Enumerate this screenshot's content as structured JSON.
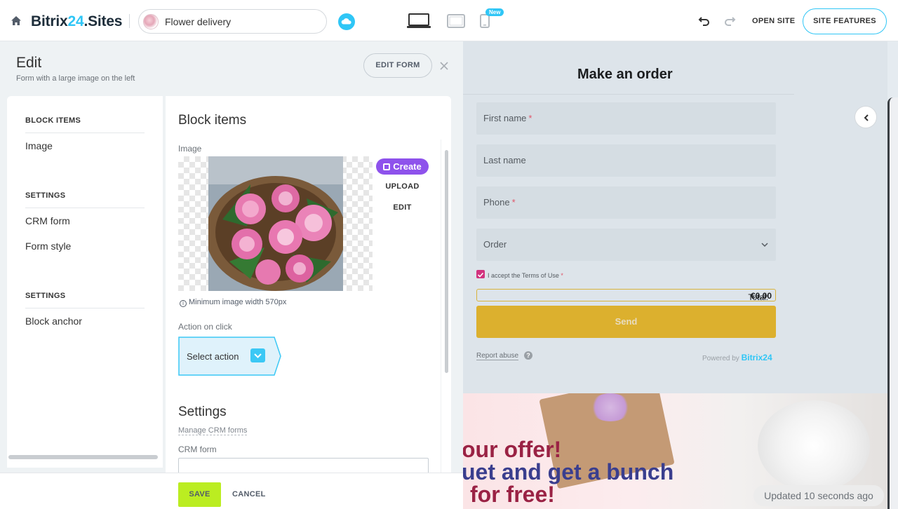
{
  "topbar": {
    "logo_part1": "Bitrix",
    "logo_part2": "24",
    "logo_part3": ".Sites",
    "site_name": "Flower delivery",
    "new_badge": "New",
    "open_site": "OPEN SITE",
    "site_features": "SITE FEATURES"
  },
  "edit": {
    "title": "Edit",
    "subtitle": "Form with a large image on the left",
    "edit_form_button": "EDIT FORM"
  },
  "sidebar": {
    "sections": [
      {
        "heading": "BLOCK ITEMS",
        "items": [
          "Image"
        ]
      },
      {
        "heading": "SETTINGS",
        "items": [
          "CRM form",
          "Form style"
        ]
      },
      {
        "heading": "SETTINGS",
        "items": [
          "Block anchor"
        ]
      }
    ]
  },
  "content": {
    "block_items_title": "Block items",
    "image_label": "Image",
    "create_button": "Create",
    "upload_button": "UPLOAD",
    "edit_button": "EDIT",
    "min_width_note": "Minimum image width 570px",
    "action_label": "Action on click",
    "select_action": "Select action",
    "settings_title": "Settings",
    "manage_crm_forms": "Manage CRM forms",
    "crm_form_label": "CRM form"
  },
  "footer": {
    "save": "SAVE",
    "cancel": "CANCEL"
  },
  "preview": {
    "form_title": "Make an order",
    "fields": [
      {
        "label": "First name",
        "required": "*"
      },
      {
        "label": "Last name",
        "required": ""
      },
      {
        "label": "Phone",
        "required": "*"
      },
      {
        "label": "Order",
        "required": ""
      }
    ],
    "terms": "I accept the Terms of Use",
    "terms_required": "*",
    "total_label": "Total:",
    "total_value": "€0.00",
    "send": "Send",
    "report_abuse": "Report abuse",
    "help": "?",
    "powered_by": "Powered by",
    "powered_brand": "Bitrix24",
    "banner_lines": [
      "our offer!",
      "uet and get a bunch",
      "for free!"
    ],
    "updated": "Updated 10 seconds ago"
  },
  "colors": {
    "accent": "#2fc6f6",
    "save_green": "#bbed21",
    "create_purple": "#8e52ec",
    "send_yellow": "#dcb02e",
    "checkbox_pink": "#d2337e"
  },
  "icons": {
    "home": "home-icon",
    "cloud": "cloud-icon",
    "desktop": "desktop-icon",
    "tablet": "tablet-icon",
    "mobile": "mobile-icon",
    "undo": "undo-icon",
    "redo": "redo-icon",
    "close": "close-icon",
    "collapse": "chevron-left-icon"
  }
}
